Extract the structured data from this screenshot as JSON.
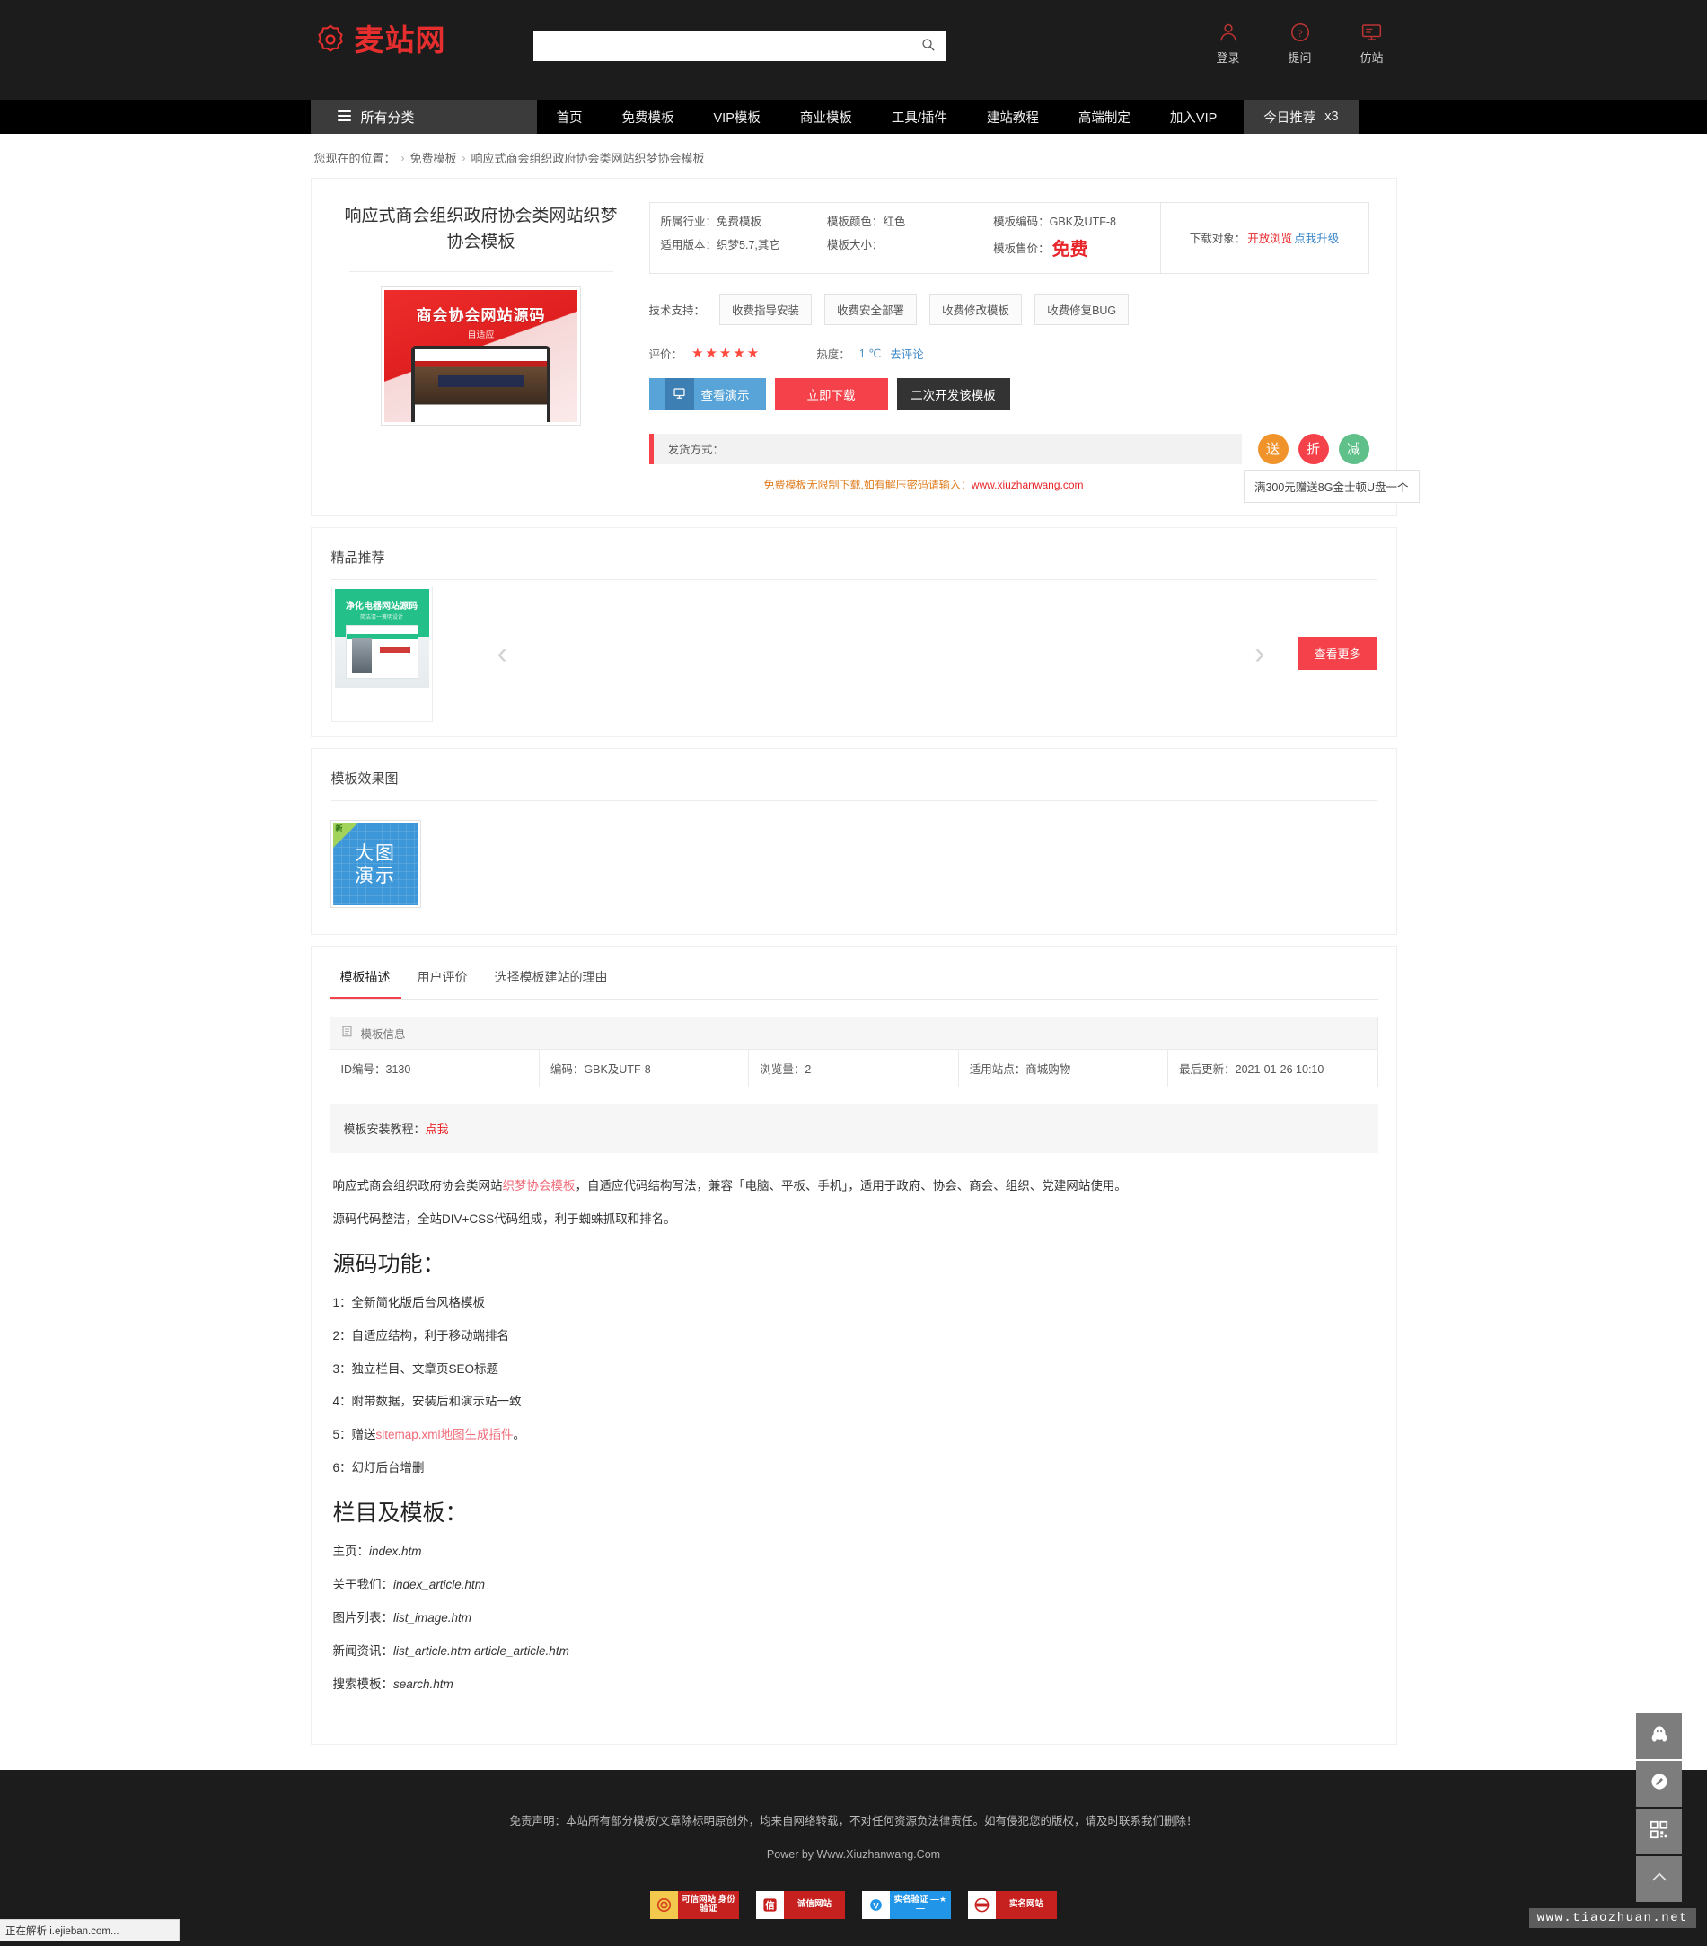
{
  "header": {
    "logo_text": "麦站网",
    "logo_icon": "gear-icon",
    "search_placeholder": "",
    "search_value": "",
    "search_icon": "search-icon",
    "tools": [
      {
        "icon": "user-icon",
        "label": "登录"
      },
      {
        "icon": "question-circle-icon",
        "label": "提问"
      },
      {
        "icon": "monitor-icon",
        "label": "仿站"
      }
    ]
  },
  "nav": {
    "category_label": "所有分类",
    "category_icon": "list-icon",
    "links": [
      "首页",
      "免费模板",
      "VIP模板",
      "商业模板",
      "工具/插件",
      "建站教程",
      "高端制定",
      "加入VIP"
    ],
    "today_label": "今日推荐",
    "today_count": "x3"
  },
  "breadcrumb": {
    "prefix": "您现在的位置：",
    "items": [
      "免费模板",
      "响应式商会组织政府协会类网站织梦协会模板"
    ]
  },
  "product": {
    "title": "响应式商会组织政府协会类网站织梦协会模板",
    "thumb": {
      "headline": "商会协会网站源码",
      "subline": "自适应"
    },
    "spec": [
      {
        "label": "所属行业：",
        "value": "免费模板"
      },
      {
        "label": "模板颜色：",
        "value": "红色"
      },
      {
        "label": "模板编码：",
        "value": "GBK及UTF-8"
      },
      {
        "label": "适用版本：",
        "value": "织梦5.7,其它"
      },
      {
        "label": "模板大小：",
        "value": ""
      },
      {
        "label": "模板售价：",
        "value": "免费"
      }
    ],
    "download_target": {
      "label": "下载对象：",
      "status": "开放浏览",
      "upgrade": "点我升级"
    },
    "support": {
      "label": "技术支持：",
      "buttons": [
        "收费指导安装",
        "收费安全部署",
        "收费修改模板",
        "收费修复BUG"
      ]
    },
    "rating": {
      "label": "评价：",
      "stars": 5,
      "heat_label": "热度：",
      "heat_value": "1 ℃",
      "comment_link": "去评论"
    },
    "actions": {
      "demo": "查看演示",
      "demo_icon": "monitor-icon",
      "download": "立即下载",
      "develop": "二次开发该模板"
    },
    "shipping": {
      "label": "发货方式：",
      "value": ""
    },
    "promos": [
      {
        "text": "送",
        "color": "#f0932b"
      },
      {
        "text": "折",
        "color": "#f5414a"
      },
      {
        "text": "减",
        "color": "#5fc08a"
      }
    ],
    "promo_tip": "满300元赠送8G金士顿U盘一个",
    "notice_prefix": "免费模板无限制下载,如有解压密码请输入：",
    "notice_url": "www.xiuzhanwang.com"
  },
  "recommend": {
    "heading": "精品推荐",
    "items": [
      {
        "headline": "净化电器网站源码",
        "subline": "简洁清一簧明设计"
      }
    ],
    "prev_icon": "chevron-left-icon",
    "next_icon": "chevron-right-icon",
    "more_label": "查看更多"
  },
  "screenshots": {
    "heading": "模板效果图",
    "badge": "新",
    "caption_line1": "大图",
    "caption_line2": "演示"
  },
  "detail": {
    "tabs": [
      {
        "label": "模板描述",
        "active": true
      },
      {
        "label": "用户评价",
        "active": false
      },
      {
        "label": "选择模板建站的理由",
        "active": false
      }
    ],
    "infobox_title": "模板信息",
    "infobox_icon": "document-icon",
    "info_cells": [
      "ID编号：3130",
      "编码：GBK及UTF-8",
      "浏览量：2",
      "适用站点：商城购物",
      "最后更新：2021-01-26 10:10"
    ],
    "tutorial_label": "模板安装教程：",
    "tutorial_link": "点我",
    "intro_1_a": "响应式商会组织政府协会类网站",
    "intro_1_link": "织梦协会模板",
    "intro_1_b": "，自适应代码结构写法，兼容「电脑、平板、手机」，适用于政府、协会、商会、组织、党建网站使用。",
    "intro_2": "源码代码整洁，全站DIV+CSS代码组成，利于蜘蛛抓取和排名。",
    "features_heading": "源码功能：",
    "features": [
      "1：全新简化版后台风格模板",
      "2：自适应结构，利于移动端排名",
      "3：独立栏目、文章页SEO标题",
      "4：附带数据，安装后和演示站一致"
    ],
    "feature_5_a": "5：赠送",
    "feature_5_link": "sitemap.xml地图生成插件",
    "feature_5_b": "。",
    "feature_6": "6：幻灯后台增删",
    "templates_heading": "栏目及模板：",
    "templates": [
      {
        "label": "主页：",
        "file": "index.htm"
      },
      {
        "label": "关于我们：",
        "file": "index_article.htm"
      },
      {
        "label": "图片列表：",
        "file": "list_image.htm"
      },
      {
        "label": "新闻资讯：",
        "file": "list_article.htm article_article.htm"
      },
      {
        "label": "搜索模板：",
        "file": "search.htm"
      }
    ]
  },
  "footer": {
    "disclaimer": "免责声明：本站所有部分模板/文章除标明原创外，均来自网络转载，不对任何资源负法律责任。如有侵犯您的版权，请及时联系我们删除！",
    "power": "Power by Www.Xiuzhanwang.Com",
    "certs": [
      {
        "label": "可信网站 身份验证"
      },
      {
        "label": "诚信网站"
      },
      {
        "label": "实名验证 —★—"
      },
      {
        "label": "实名网站"
      }
    ]
  },
  "float_sidebar": {
    "buttons": [
      {
        "icon": "qq-penguin-icon",
        "name": "qq-contact"
      },
      {
        "icon": "pencil-circle-icon",
        "name": "feedback"
      },
      {
        "icon": "qrcode-icon",
        "name": "qrcode"
      },
      {
        "icon": "chevron-up-icon",
        "name": "back-to-top"
      }
    ]
  },
  "watermark": "www.tiaozhuan.net",
  "status_bar": "正在解析 i.ejieban.com..."
}
